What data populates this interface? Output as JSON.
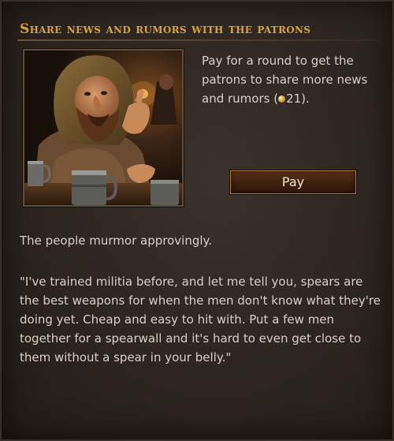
{
  "dialog": {
    "title": "Share news and rumors with the patrons",
    "description_prefix": "Pay for a round to get the patrons to share more news and rumors (",
    "cost": "21",
    "description_suffix": ").",
    "pay_label": "Pay",
    "mood": "The people murmor approvingly.",
    "quote": "\"I've trained militia before, and let me tell you, spears are the best weapons for when the men don't know what they're doing yet. Cheap and easy to hit with. Put a few men together for a spearwall and it's hard to even get close to them without a spear in your belly.\""
  },
  "icons": {
    "cost_icon": "gold-coin-icon"
  },
  "colors": {
    "title": "#d9a23a",
    "body_text": "#d9d0c4",
    "button_border": "#b07a35",
    "button_fill": "#3d200f"
  }
}
